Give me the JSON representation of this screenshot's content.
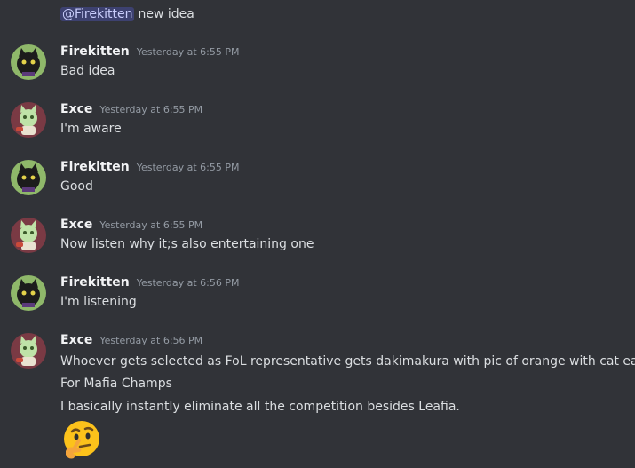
{
  "first_message": {
    "mention": "@Firekitten",
    "text": "new idea"
  },
  "messages": [
    {
      "author": "Firekitten",
      "timestamp": "Yesterday at 6:55 PM",
      "lines": [
        "Bad idea"
      ],
      "avatar": "firekitten-avatar"
    },
    {
      "author": "Exce",
      "timestamp": "Yesterday at 6:55 PM",
      "lines": [
        "I'm aware"
      ],
      "avatar": "exce-avatar"
    },
    {
      "author": "Firekitten",
      "timestamp": "Yesterday at 6:55 PM",
      "lines": [
        "Good"
      ],
      "avatar": "firekitten-avatar"
    },
    {
      "author": "Exce",
      "timestamp": "Yesterday at 6:55 PM",
      "lines": [
        "Now listen why it;s also entertaining one"
      ],
      "avatar": "exce-avatar"
    },
    {
      "author": "Firekitten",
      "timestamp": "Yesterday at 6:56 PM",
      "lines": [
        "I'm listening"
      ],
      "avatar": "firekitten-avatar"
    },
    {
      "author": "Exce",
      "timestamp": "Yesterday at 6:56 PM",
      "lines": [
        "Whoever gets selected as FoL representative gets dakimakura with pic of orange with cat ears.",
        "For Mafia Champs",
        "I basically instantly eliminate all the competition besides Leafia."
      ],
      "emoji": "thinking-face-emoji",
      "avatar": "exce-avatar"
    }
  ],
  "colors": {
    "background": "#313338",
    "text": "#dbdee1",
    "username": "#f2f3f5",
    "timestamp": "#949ba4",
    "mention_bg": "#3c4270",
    "mention_text": "#c9cdfb"
  }
}
